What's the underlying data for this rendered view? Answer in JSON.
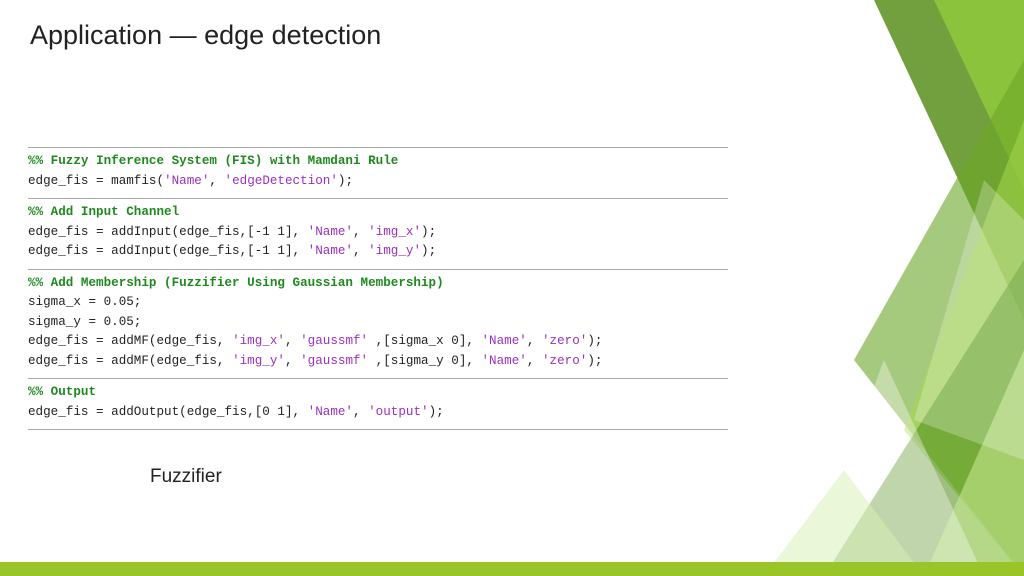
{
  "title": "Application — edge detection",
  "caption": "Fuzzifier",
  "code": {
    "s1": {
      "header": "%% Fuzzy Inference System (FIS) with Mamdani Rule",
      "l1a": "edge_fis = mamfis(",
      "l1b": "'Name'",
      "l1c": ", ",
      "l1d": "'edgeDetection'",
      "l1e": ");"
    },
    "s2": {
      "header": "%% Add Input Channel",
      "l1a": "edge_fis = addInput(edge_fis,[-1 1], ",
      "l1b": "'Name'",
      "l1c": ", ",
      "l1d": "'img_x'",
      "l1e": ");",
      "l2a": "edge_fis = addInput(edge_fis,[-1 1], ",
      "l2b": "'Name'",
      "l2c": ", ",
      "l2d": "'img_y'",
      "l2e": ");"
    },
    "s3": {
      "header": "%% Add Membership (Fuzzifier Using Gaussian Membership)",
      "l1": "sigma_x = 0.05;",
      "l2": "sigma_y = 0.05;",
      "l3a": "edge_fis = addMF(edge_fis, ",
      "l3b": "'img_x'",
      "l3c": ", ",
      "l3d": "'gaussmf'",
      "l3e": " ,[sigma_x 0], ",
      "l3f": "'Name'",
      "l3g": ", ",
      "l3h": "'zero'",
      "l3i": ");",
      "l4a": "edge_fis = addMF(edge_fis, ",
      "l4b": "'img_y'",
      "l4c": ", ",
      "l4d": "'gaussmf'",
      "l4e": " ,[sigma_y 0], ",
      "l4f": "'Name'",
      "l4g": ", ",
      "l4h": "'zero'",
      "l4i": ");"
    },
    "s4": {
      "header": "%% Output",
      "l1a": "edge_fis = addOutput(edge_fis,[0 1], ",
      "l1b": "'Name'",
      "l1c": ", ",
      "l1d": "'output'",
      "l1e": ");"
    }
  }
}
